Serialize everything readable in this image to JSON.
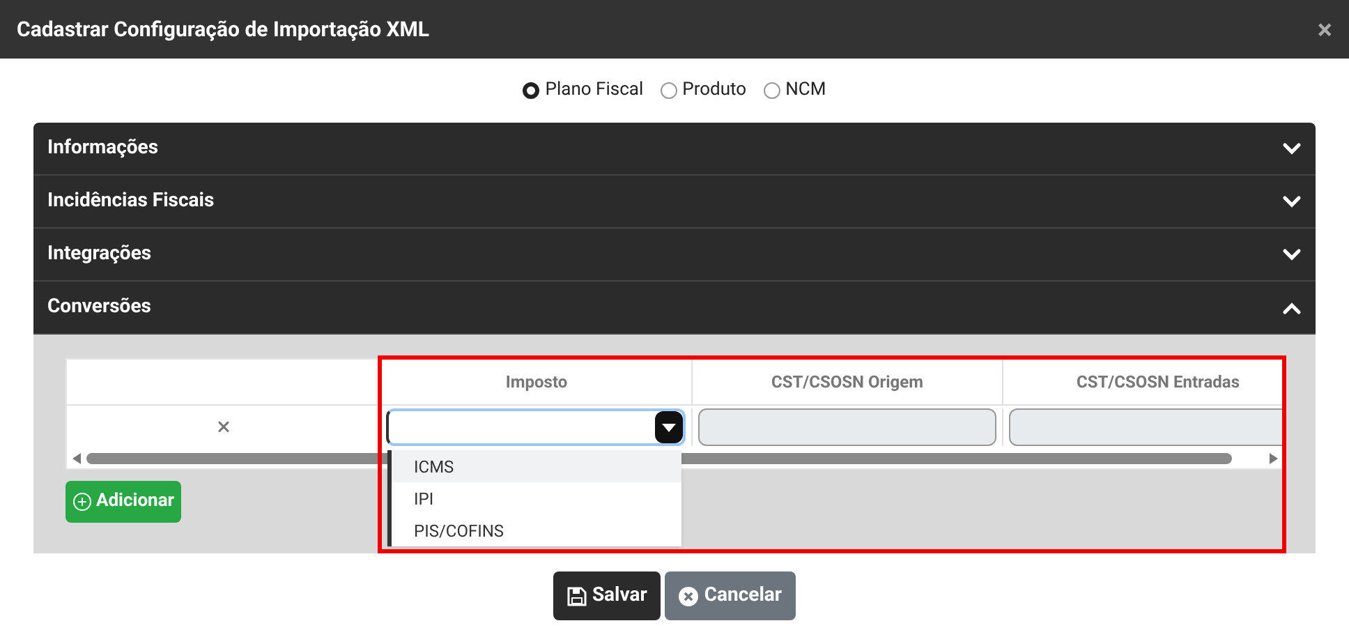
{
  "window": {
    "title": "Cadastrar Configuração de Importação XML",
    "close": "×"
  },
  "radios": [
    {
      "label": "Plano Fiscal",
      "selected": true
    },
    {
      "label": "Produto",
      "selected": false
    },
    {
      "label": "NCM",
      "selected": false
    }
  ],
  "sections": [
    {
      "title": "Informações",
      "expanded": false
    },
    {
      "title": "Incidências Fiscais",
      "expanded": false
    },
    {
      "title": "Integrações",
      "expanded": false
    },
    {
      "title": "Conversões",
      "expanded": true
    }
  ],
  "table": {
    "columns": [
      "Imposto",
      "CST/CSOSN Origem",
      "CST/CSOSN Entradas"
    ],
    "rows": [
      {
        "remove": "×"
      }
    ]
  },
  "dropdown": {
    "open": true,
    "options": [
      {
        "label": "ICMS",
        "selected": true
      },
      {
        "label": "IPI",
        "selected": false
      },
      {
        "label": "PIS/COFINS",
        "selected": false
      }
    ]
  },
  "highlight": true,
  "add_button": "Adicionar",
  "buttons": [
    {
      "label": "Salvar",
      "kind": "save"
    },
    {
      "label": "Cancelar",
      "kind": "cancel"
    }
  ]
}
